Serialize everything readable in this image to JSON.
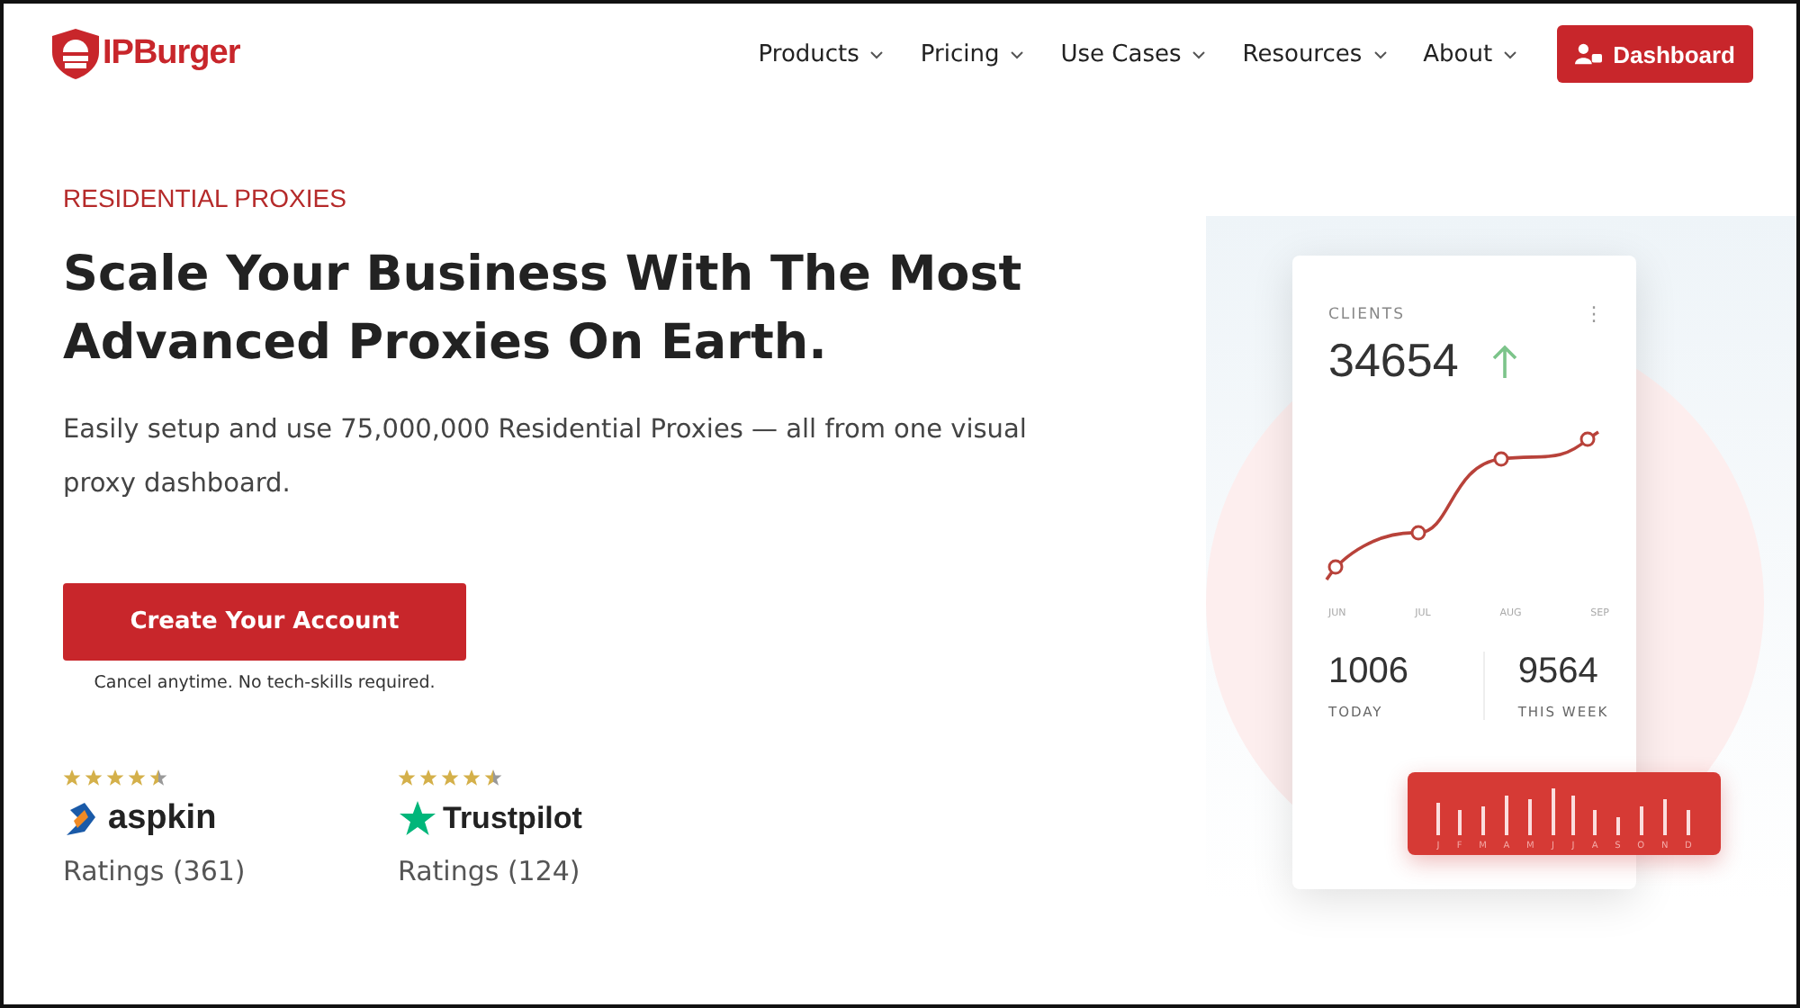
{
  "header": {
    "logo": "IPBurger",
    "nav": [
      {
        "label": "Products",
        "caret": true
      },
      {
        "label": "Pricing",
        "caret": true
      },
      {
        "label": "Use Cases",
        "caret": true
      },
      {
        "label": "Resources",
        "caret": true
      },
      {
        "label": "About",
        "caret": true
      }
    ],
    "dashboard_button": "Dashboard"
  },
  "hero": {
    "eyebrow": "RESIDENTIAL PROXIES",
    "title": "Scale Your Business With The Most Advanced Proxies On Earth.",
    "text": "Easily setup and use 75,000,000 Residential Proxies — all from one visual proxy dashboard.",
    "cta": "Create Your Account",
    "cta_note": "Cancel anytime. No tech-skills required."
  },
  "ratings": [
    {
      "brand": "aspkin",
      "kind": "aspkin",
      "stars": 4.5,
      "count": "Ratings (361)"
    },
    {
      "brand": "Trustpilot",
      "kind": "trustpilot",
      "stars": 4.5,
      "count": "Ratings (124)"
    }
  ],
  "dashboard_card": {
    "label": "CLIENTS",
    "menu": "⋮",
    "value": "34654",
    "months": [
      "JUN",
      "JUL",
      "AUG",
      "SEP"
    ],
    "stats": [
      {
        "value": "1006",
        "label": "TODAY"
      },
      {
        "value": "9564",
        "label": "THIS WEEK"
      }
    ],
    "strip_letters": [
      "J",
      "F",
      "M",
      "A",
      "M",
      "J",
      "J",
      "A",
      "S",
      "O",
      "N",
      "D"
    ]
  }
}
